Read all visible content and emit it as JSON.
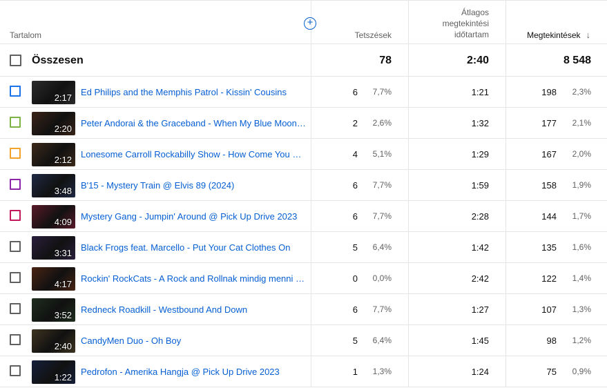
{
  "header": {
    "content": "Tartalom",
    "likes": "Tetszések",
    "avg_line1": "Átlagos",
    "avg_line2": "megtekintési",
    "avg_line3": "időtartam",
    "views": "Megtekintések",
    "add_icon": "plus-circle-icon",
    "sort_icon": "arrow-down-icon"
  },
  "total": {
    "label": "Összesen",
    "likes": "78",
    "avg": "2:40",
    "views": "8 548"
  },
  "rows": [
    {
      "title": "Ed Philips and the Memphis Patrol - Kissin' Cousins",
      "duration": "2:17",
      "likes": "6",
      "likes_pct": "7,7%",
      "avg": "1:21",
      "views": "198",
      "views_pct": "2,3%",
      "color": "#1a73e8",
      "thumb": "#2b2b2b"
    },
    {
      "title": "Peter Andorai & the Graceband - When My Blue Moon Turns to Gold Again",
      "duration": "2:20",
      "likes": "2",
      "likes_pct": "2,6%",
      "avg": "1:32",
      "views": "177",
      "views_pct": "2,1%",
      "color": "#7cb342",
      "thumb": "#3a2418"
    },
    {
      "title": "Lonesome Carroll Rockabilly Show - How Come You Do Me",
      "duration": "2:12",
      "likes": "4",
      "likes_pct": "5,1%",
      "avg": "1:29",
      "views": "167",
      "views_pct": "2,0%",
      "color": "#f2a22a",
      "thumb": "#3d2a1a"
    },
    {
      "title": "B'15 - Mystery Train @ Elvis 89 (2024)",
      "duration": "3:48",
      "likes": "6",
      "likes_pct": "7,7%",
      "avg": "1:59",
      "views": "158",
      "views_pct": "1,9%",
      "color": "#8e24aa",
      "thumb": "#1f2a44"
    },
    {
      "title": "Mystery Gang - Jumpin' Around @ Pick Up Drive 2023",
      "duration": "4:09",
      "likes": "6",
      "likes_pct": "7,7%",
      "avg": "2:28",
      "views": "144",
      "views_pct": "1,7%",
      "color": "#c2185b",
      "thumb": "#5a1a2a"
    },
    {
      "title": "Black Frogs feat. Marcello - Put Your Cat Clothes On",
      "duration": "3:31",
      "likes": "5",
      "likes_pct": "6,4%",
      "avg": "1:42",
      "views": "135",
      "views_pct": "1,6%",
      "color": "#606060",
      "thumb": "#2a1f3d"
    },
    {
      "title": "Rockin' RockCats - A Rock and Rollnak mindig menni kell",
      "duration": "4:17",
      "likes": "0",
      "likes_pct": "0,0%",
      "avg": "2:42",
      "views": "122",
      "views_pct": "1,4%",
      "color": "#606060",
      "thumb": "#4a2414"
    },
    {
      "title": "Redneck Roadkill - Westbound And Down",
      "duration": "3:52",
      "likes": "6",
      "likes_pct": "7,7%",
      "avg": "1:27",
      "views": "107",
      "views_pct": "1,3%",
      "color": "#606060",
      "thumb": "#1e2e1e"
    },
    {
      "title": "CandyMen Duo - Oh Boy",
      "duration": "2:40",
      "likes": "5",
      "likes_pct": "6,4%",
      "avg": "1:45",
      "views": "98",
      "views_pct": "1,2%",
      "color": "#606060",
      "thumb": "#3e3420"
    },
    {
      "title": "Pedrofon - Amerika Hangja @ Pick Up Drive 2023",
      "duration": "1:22",
      "likes": "1",
      "likes_pct": "1,3%",
      "avg": "1:24",
      "views": "75",
      "views_pct": "0,9%",
      "color": "#606060",
      "thumb": "#14203a"
    }
  ]
}
